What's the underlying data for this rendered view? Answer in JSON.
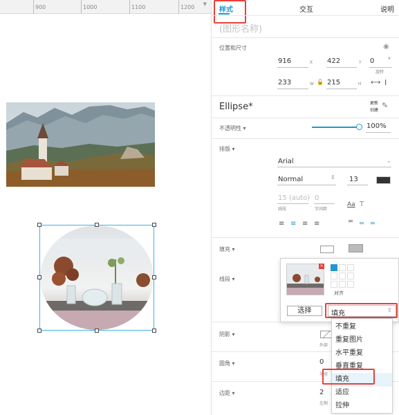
{
  "ruler": {
    "ticks": [
      "900",
      "1000",
      "1100",
      "1200"
    ]
  },
  "tabs": {
    "style": "样式",
    "interact": "交互",
    "notes": "说明"
  },
  "shape_name_placeholder": "(图形名称)",
  "position_size": {
    "label": "位置和尺寸",
    "x": "916",
    "x_axis": "X",
    "y": "422",
    "y_axis": "Y",
    "rotation": "0",
    "rotation_unit": "°",
    "rotation_label": "旋转",
    "w": "233",
    "w_axis": "W",
    "h": "215",
    "h_axis": "H"
  },
  "shape_type": {
    "name": "Ellipse*",
    "update_label_1": "更新",
    "update_label_2": "创建"
  },
  "opacity": {
    "label": "不透明性 ▾",
    "value": "100%",
    "level": 1.0
  },
  "typography": {
    "label": "排版 ▾",
    "font": "Arial",
    "weight": "Normal",
    "size": "13",
    "line_height": "15 (auto)",
    "line_height_label": "线段",
    "letter_spacing": "0",
    "letter_spacing_label": "字间距",
    "text_sample": "Aa"
  },
  "fill": {
    "label": "填充 ▾"
  },
  "border": {
    "label": "线段 ▾"
  },
  "shadow": {
    "label": "阴影 ▾",
    "outer_label": "外部"
  },
  "corner": {
    "label": "圆角 ▾",
    "value": "0",
    "sub_label": "半径"
  },
  "padding": {
    "label": "边距 ▾",
    "value": "2",
    "sub_label": "左侧"
  },
  "image_popup": {
    "align_label": "对齐",
    "select_button": "选择",
    "fill_mode": "填充",
    "options": [
      "不重复",
      "重复图片",
      "水平重复",
      "垂直重复",
      "填充",
      "适应",
      "拉伸"
    ],
    "selected_option": "填充"
  },
  "colors": {
    "accent": "#2196d3",
    "highlight_red": "#e8403a",
    "selection": "#3cb4e5"
  }
}
